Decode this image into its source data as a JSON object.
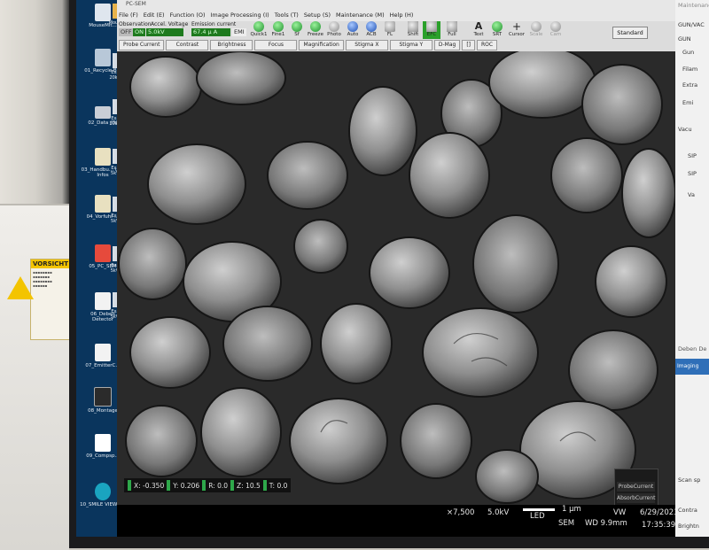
{
  "app": {
    "title": "PC-SEM",
    "menus": [
      "File (F)",
      "Edit (E)",
      "Function (O)",
      "Image Processing (I)",
      "Tools (T)",
      "Setup (S)",
      "Maintenance (M)",
      "Help (H)"
    ]
  },
  "toolbar": {
    "labels": [
      "Observation",
      "Accel. Voltage",
      "Emission current"
    ],
    "off_label": "OFF",
    "on_label": "ON",
    "accel_voltage": "5.0kV",
    "emission_current": "67.4 µ A",
    "emi_label": "EMI",
    "icon_buttons": [
      "Quick1",
      "Fine1",
      "Sf",
      "Freeze",
      "Photo",
      "Auto",
      "ACB",
      "FL",
      "Shift",
      "EFC",
      "Full",
      "Text",
      "SRT",
      "Cursor",
      "Scale",
      "Cam"
    ],
    "tabs": [
      "Probe Current",
      "Contrast",
      "Brightness",
      "Focus",
      "Magnification",
      "Stigma X",
      "Stigma Y",
      "D-Mag",
      "[]",
      "ROC"
    ],
    "standard_label": "Standard"
  },
  "desktop": {
    "icons": [
      "MouseMit...",
      "01_Recycle Bin",
      "02_Data (D)",
      "03_Handbu... und Infos",
      "04_Vorfuhr-...",
      "05_PC_SEM",
      "06_Deben Detector",
      "07_EmitterC...",
      "08_Montage",
      "09_Compsp...",
      "10_SMILE VIEW P..."
    ],
    "right_column": [
      "Mou with",
      "Examp 20kV_LE",
      "Examp 20kV_LE",
      "Examp 5kV_LE",
      "Examp 5kV_LE",
      "Examp 5kV_BE",
      "Examp 5kV_BE"
    ]
  },
  "coords": {
    "x": "X: -0.350",
    "y": "Y: 0.206",
    "r": "R: 0.0",
    "z": "Z: 10.5",
    "t": "T: 0.0"
  },
  "overlay": {
    "probe": "ProbeCurrent",
    "absorb": "AbsorbCurrent"
  },
  "status": {
    "mag": "×7,500",
    "kv": "5.0kV",
    "detector": "LED",
    "scale": "1 μm",
    "mode": "SEM",
    "vw_label": "VW",
    "wd": "WD 9.9mm",
    "date": "6/29/2023",
    "time": "17:35:39"
  },
  "right_panel": {
    "title": "Maintenance",
    "items": [
      "GUN/VAC",
      "GUN",
      "Gun",
      "Filam",
      "Extra",
      "Emi",
      "Vacu",
      "SIP",
      "SIP",
      "Va"
    ],
    "deben_title": "Deben De",
    "imaging": "Imaging",
    "extras": [
      "Scan sp",
      "Contra",
      "Brightn",
      "Black l"
    ]
  },
  "warning": {
    "heading": "VORSICHT"
  }
}
